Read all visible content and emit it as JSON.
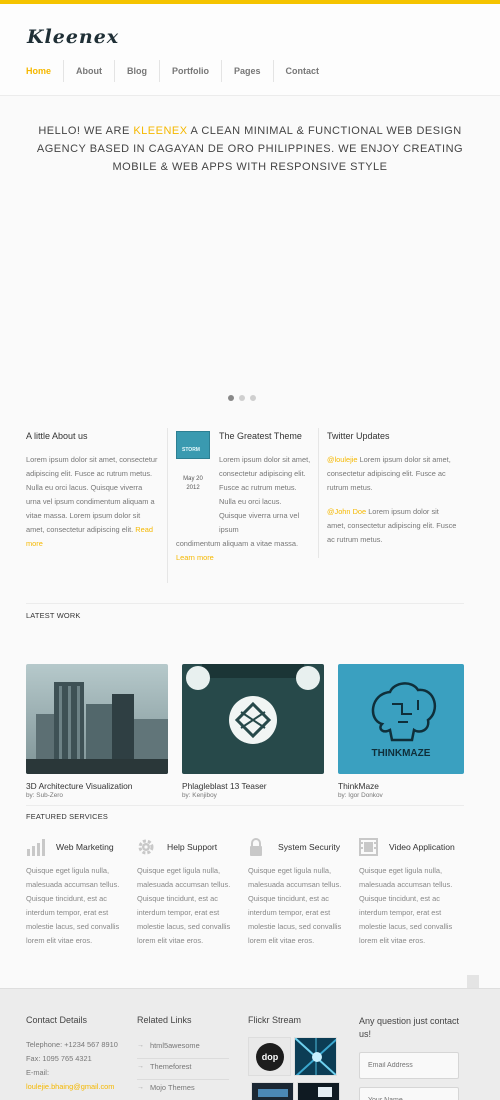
{
  "brand": {
    "logo": "Kleenex",
    "accent": "#f5b800"
  },
  "nav": {
    "items": [
      "Home",
      "About",
      "Blog",
      "Portfolio",
      "Pages",
      "Contact"
    ],
    "active": "Home"
  },
  "hero": {
    "pre": "HELLO! WE ARE ",
    "highlight": "KLEENEX",
    "post": " A CLEAN MINIMAL & FUNCTIONAL WEB DESIGN AGENCY BASED IN CAGAYAN DE ORO PHILIPPINES. WE ENJOY CREATING MOBILE & WEB APPS WITH RESPONSIVE STYLE",
    "slider_dots": 3,
    "slider_active": 1
  },
  "about": {
    "title": "A little About us",
    "text": "Lorem ipsum dolor sit amet, consectetur adipiscing elit. Fusce ac rutrum metus. Nulla eu orci lacus. Quisque viverra urna vel ipsum condimentum aliquam a vitae massa. Lorem ipsum dolor sit amet, consectetur adipiscing elit. ",
    "read_more": "Read more"
  },
  "theme_post": {
    "title": "The Greatest Theme",
    "thumb_label": "STORM",
    "date_line1": "May 20",
    "date_line2": "2012",
    "text_top": "Lorem ipsum dolor sit amet, consectetur adipiscing elit. Fusce ac rutrum metus. Nulla eu orci lacus. Quisque viverra urna vel ipsum",
    "text_bottom": "condimentum aliquam a vitae massa. ",
    "learn_more": "Learn more"
  },
  "twitter": {
    "title": "Twitter Updates",
    "tweets": [
      {
        "handle": "@loulejie",
        "text": " Lorem ipsum dolor sit amet, consectetur adipiscing elit. Fusce ac rutrum metus."
      },
      {
        "handle": "@John Doe",
        "text": " Lorem ipsum dolor sit amet, consectetur adipiscing elit. Fusce ac rutrum metus."
      }
    ]
  },
  "latest_work": {
    "title": "LATEST WORK",
    "items": [
      {
        "title": "3D Architecture Visualization",
        "by": "by: Sub-Zero"
      },
      {
        "title": "Phlagleblast 13 Teaser",
        "by": "by: Kenjiboy"
      },
      {
        "title": "ThinkMaze",
        "by": "by: Igor Donkov",
        "image_text": "THINKMAZE"
      }
    ]
  },
  "services": {
    "title": "FEATURED SERVICES",
    "items": [
      {
        "title": "Web Marketing",
        "icon": "bar-chart-icon",
        "text": "Quisque eget ligula nulla, malesuada accumsan tellus. Quisque tincidunt, est ac interdum tempor, erat est molestie lacus, sed convallis lorem elit vitae eros."
      },
      {
        "title": "Help Support",
        "icon": "gear-icon",
        "text": "Quisque eget ligula nulla, malesuada accumsan tellus. Quisque tincidunt, est ac interdum tempor, erat est molestie lacus, sed convallis lorem elit vitae eros."
      },
      {
        "title": "System Security",
        "icon": "lock-icon",
        "text": "Quisque eget ligula nulla, malesuada accumsan tellus. Quisque tincidunt, est ac interdum tempor, erat est molestie lacus, sed convallis lorem elit vitae eros."
      },
      {
        "title": "Video Application",
        "icon": "film-icon",
        "text": "Quisque eget ligula nulla, malesuada accumsan tellus. Quisque tincidunt, est ac interdum tempor, erat est molestie lacus, sed convallis lorem elit vitae eros."
      }
    ]
  },
  "footer": {
    "contact_title": "Contact Details",
    "telephone": "Telephone: +1234 567 8910",
    "fax": "Fax: 1095 765 4321",
    "email_label": "E-mail:",
    "email": "loulejie.bhaing@gmail.com",
    "related_title": "Related Links",
    "links": [
      "html5awesome",
      "Themeforest",
      "Mojo Themes"
    ],
    "flickr_title": "Flickr Stream",
    "flickr_logo_text": "dop",
    "question_title": "Any question just contact us!",
    "email_placeholder": "Email Address",
    "name_placeholder": "Your Name"
  }
}
